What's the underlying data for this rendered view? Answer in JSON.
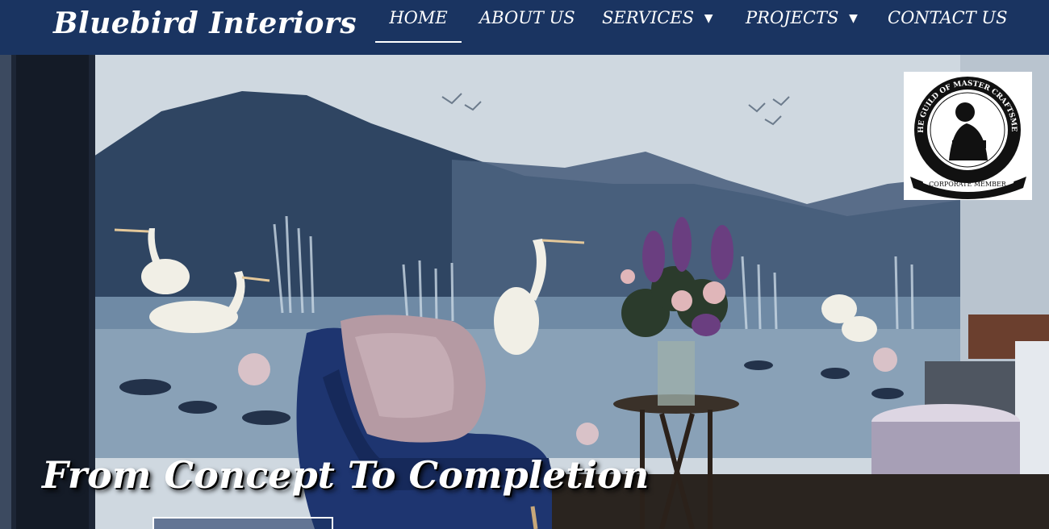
{
  "brand": {
    "name": "Bluebird Interiors"
  },
  "nav": {
    "items": [
      {
        "label": "HOME",
        "active": true,
        "has_dropdown": false
      },
      {
        "label": "ABOUT US",
        "active": false,
        "has_dropdown": false
      },
      {
        "label": "SERVICES",
        "active": false,
        "has_dropdown": true
      },
      {
        "label": "PROJECTS",
        "active": false,
        "has_dropdown": true
      },
      {
        "label": "CONTACT US",
        "active": false,
        "has_dropdown": false
      }
    ],
    "dropdown_icon": "caret-down-icon"
  },
  "hero": {
    "tagline": "From Concept To Completion",
    "badge": {
      "top_text": "THE GUILD OF MASTER CRAFTSMEN",
      "ribbon_text": "CORPORATE MEMBER"
    }
  },
  "colors": {
    "nav_background": "#1a3461",
    "nav_text": "#ffffff"
  }
}
